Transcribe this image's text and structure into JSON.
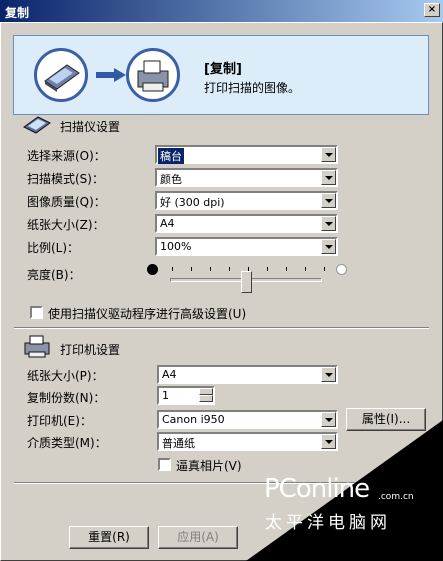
{
  "window": {
    "title": "复制",
    "close_glyph": "×"
  },
  "banner": {
    "title": "[复制]",
    "subtitle": "打印扫描的图像。",
    "icons": [
      "scanner-icon",
      "arrow-right-icon",
      "printer-icon"
    ]
  },
  "scanner_settings": {
    "heading": "扫描仪设置",
    "icon": "scanner-icon",
    "rows": [
      {
        "label": "选择来源(O)：",
        "value": "稿台"
      },
      {
        "label": "扫描模式(S)：",
        "value": "颜色"
      },
      {
        "label": "图像质量(Q)：",
        "value": "好 (300 dpi)"
      },
      {
        "label": "纸张大小(Z)：",
        "value": "A4"
      },
      {
        "label": "比例(L)：",
        "value": "100%"
      }
    ],
    "brightness_label": "亮度(B)：",
    "brightness_level": 0.5,
    "advanced_checkbox": {
      "label": "使用扫描仪驱动程序进行高级设置(U)",
      "checked": false
    }
  },
  "printer_settings": {
    "heading": "打印机设置",
    "icon": "printer-icon",
    "paper_size": {
      "label": "纸张大小(P)：",
      "value": "A4"
    },
    "copies": {
      "label": "复制份数(N)：",
      "value": "1"
    },
    "printer": {
      "label": "打印机(E)：",
      "value": "Canon i950",
      "properties_button": "属性(I)..."
    },
    "media_type": {
      "label": "介质类型(M)：",
      "value": "普通纸"
    },
    "photo_checkbox": {
      "label": "逼真相片(V)",
      "checked": false
    }
  },
  "buttons": {
    "reset": "重置(R)",
    "apply": "应用(A)"
  },
  "watermark": {
    "logo": "PConline",
    "domain": ".com.cn",
    "tagline": "太平洋电脑网"
  }
}
